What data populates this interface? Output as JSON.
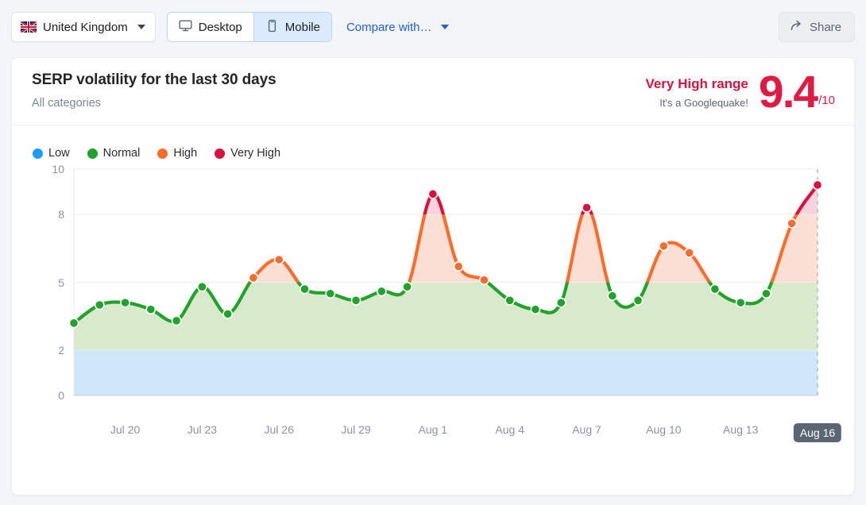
{
  "toolbar": {
    "country": {
      "label": "United Kingdom",
      "icon": "uk-flag-icon",
      "chevron": "chevron-down-icon"
    },
    "devices": [
      {
        "label": "Desktop",
        "icon": "desktop-icon",
        "active": false
      },
      {
        "label": "Mobile",
        "icon": "mobile-icon",
        "active": true
      }
    ],
    "compare": {
      "label": "Compare with…",
      "chevron": "chevron-down-icon"
    },
    "share": {
      "label": "Share",
      "icon": "share-arrow-icon"
    }
  },
  "card": {
    "title": "SERP volatility for the last 30 days",
    "subtitle": "All categories",
    "score": {
      "range_label": "Very High range",
      "note": "It's a Googlequake!",
      "value": "9.4",
      "denominator": "/10",
      "color": "#e01b43"
    }
  },
  "legend": [
    {
      "label": "Low",
      "color": "#1a9dfb"
    },
    {
      "label": "Normal",
      "color": "#21a32b"
    },
    {
      "label": "High",
      "color": "#fb6d2e"
    },
    {
      "label": "Very High",
      "color": "#d9113f"
    }
  ],
  "chart_data": {
    "type": "area",
    "title": "SERP volatility for the last 30 days",
    "xlabel": "",
    "ylabel": "",
    "ylim": [
      0,
      10
    ],
    "yticks": [
      0,
      2,
      5,
      8,
      10
    ],
    "grid": true,
    "legend_position": "top-left",
    "bands": [
      {
        "name": "Low",
        "from": 0,
        "to": 2,
        "fill": "#cde6fa",
        "color": "#1a9dfb"
      },
      {
        "name": "Normal",
        "from": 2,
        "to": 5,
        "fill": "#d8e9cc",
        "color": "#21a32b"
      },
      {
        "name": "High",
        "from": 5,
        "to": 8,
        "fill": "#fbdfd3",
        "color": "#fb6d2e"
      },
      {
        "name": "Very High",
        "from": 8,
        "to": 10,
        "fill": "#f7d3dd",
        "color": "#d9113f"
      }
    ],
    "xtick_labels": [
      "Jul 20",
      "Jul 23",
      "Jul 26",
      "Jul 29",
      "Aug 1",
      "Aug 4",
      "Aug 7",
      "Aug 10",
      "Aug 13",
      "Aug 16"
    ],
    "today_label": "Aug 16",
    "x": [
      "Jul 18",
      "Jul 19",
      "Jul 20",
      "Jul 21",
      "Jul 22",
      "Jul 23",
      "Jul 24",
      "Jul 25",
      "Jul 26",
      "Jul 27",
      "Jul 28",
      "Jul 29",
      "Jul 30",
      "Jul 31",
      "Aug 1",
      "Aug 2",
      "Aug 3",
      "Aug 4",
      "Aug 5",
      "Aug 6",
      "Aug 7",
      "Aug 8",
      "Aug 9",
      "Aug 10",
      "Aug 11",
      "Aug 12",
      "Aug 13",
      "Aug 14",
      "Aug 15",
      "Aug 16"
    ],
    "values": [
      3.2,
      4.0,
      4.1,
      3.8,
      3.3,
      4.8,
      3.6,
      5.2,
      6.0,
      4.7,
      4.5,
      4.2,
      4.6,
      4.8,
      8.9,
      5.7,
      5.1,
      4.2,
      3.8,
      4.1,
      8.3,
      4.4,
      4.2,
      6.6,
      6.3,
      4.7,
      4.1,
      4.5,
      7.6,
      9.3
    ],
    "series": [
      {
        "name": "SERP volatility",
        "values": [
          3.2,
          4.0,
          4.1,
          3.8,
          3.3,
          4.8,
          3.6,
          5.2,
          6.0,
          4.7,
          4.5,
          4.2,
          4.6,
          4.8,
          8.9,
          5.7,
          5.1,
          4.2,
          3.8,
          4.1,
          8.3,
          4.4,
          4.2,
          6.6,
          6.3,
          4.7,
          4.1,
          4.5,
          7.6,
          9.3
        ]
      }
    ]
  }
}
